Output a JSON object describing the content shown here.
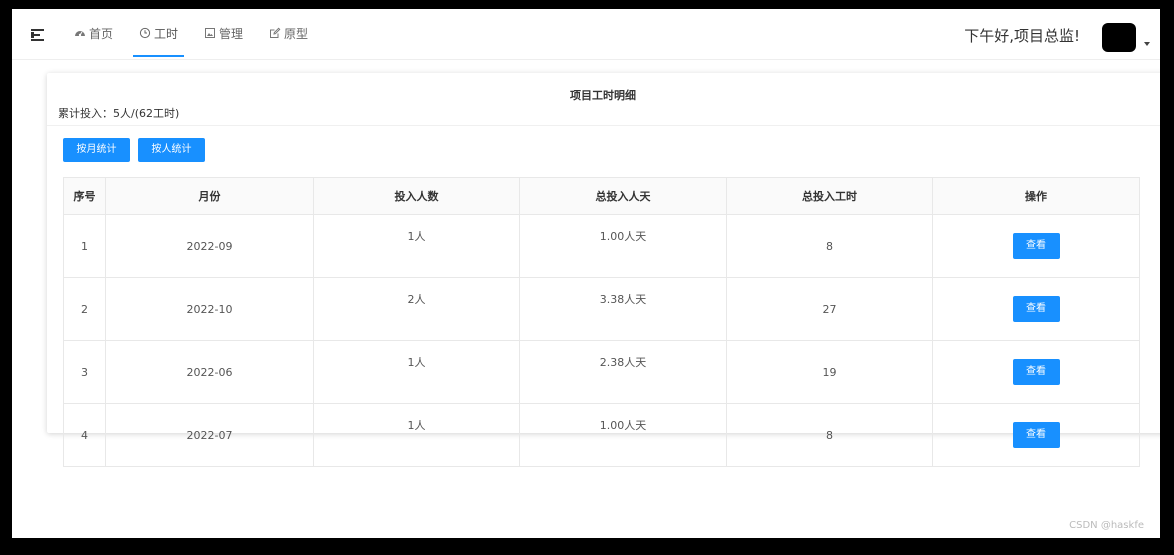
{
  "header": {
    "nav": [
      {
        "label": "首页",
        "icon": "dashboard-icon",
        "active": false
      },
      {
        "label": "工时",
        "icon": "clock-icon",
        "active": true
      },
      {
        "label": "管理",
        "icon": "image-icon",
        "active": false
      },
      {
        "label": "原型",
        "icon": "edit-icon",
        "active": false
      }
    ],
    "greeting": "下午好,项目总监!"
  },
  "card": {
    "title": "项目工时明细",
    "summary": "累计投入：5人/(62工时)",
    "buttons": {
      "by_month": "按月统计",
      "by_person": "按人统计"
    }
  },
  "table": {
    "columns": [
      "序号",
      "月份",
      "投入人数",
      "总投入人天",
      "总投入工时",
      "操作"
    ],
    "rows": [
      {
        "index": "1",
        "month": "2022-09",
        "people": "1人",
        "person_days": "1.00人天",
        "hours": "8",
        "action": "查看"
      },
      {
        "index": "2",
        "month": "2022-10",
        "people": "2人",
        "person_days": "3.38人天",
        "hours": "27",
        "action": "查看"
      },
      {
        "index": "3",
        "month": "2022-06",
        "people": "1人",
        "person_days": "2.38人天",
        "hours": "19",
        "action": "查看"
      },
      {
        "index": "4",
        "month": "2022-07",
        "people": "1人",
        "person_days": "1.00人天",
        "hours": "8",
        "action": "查看"
      }
    ]
  },
  "watermark": "CSDN @haskfe",
  "colors": {
    "accent": "#1890ff",
    "frame": "#000000"
  }
}
